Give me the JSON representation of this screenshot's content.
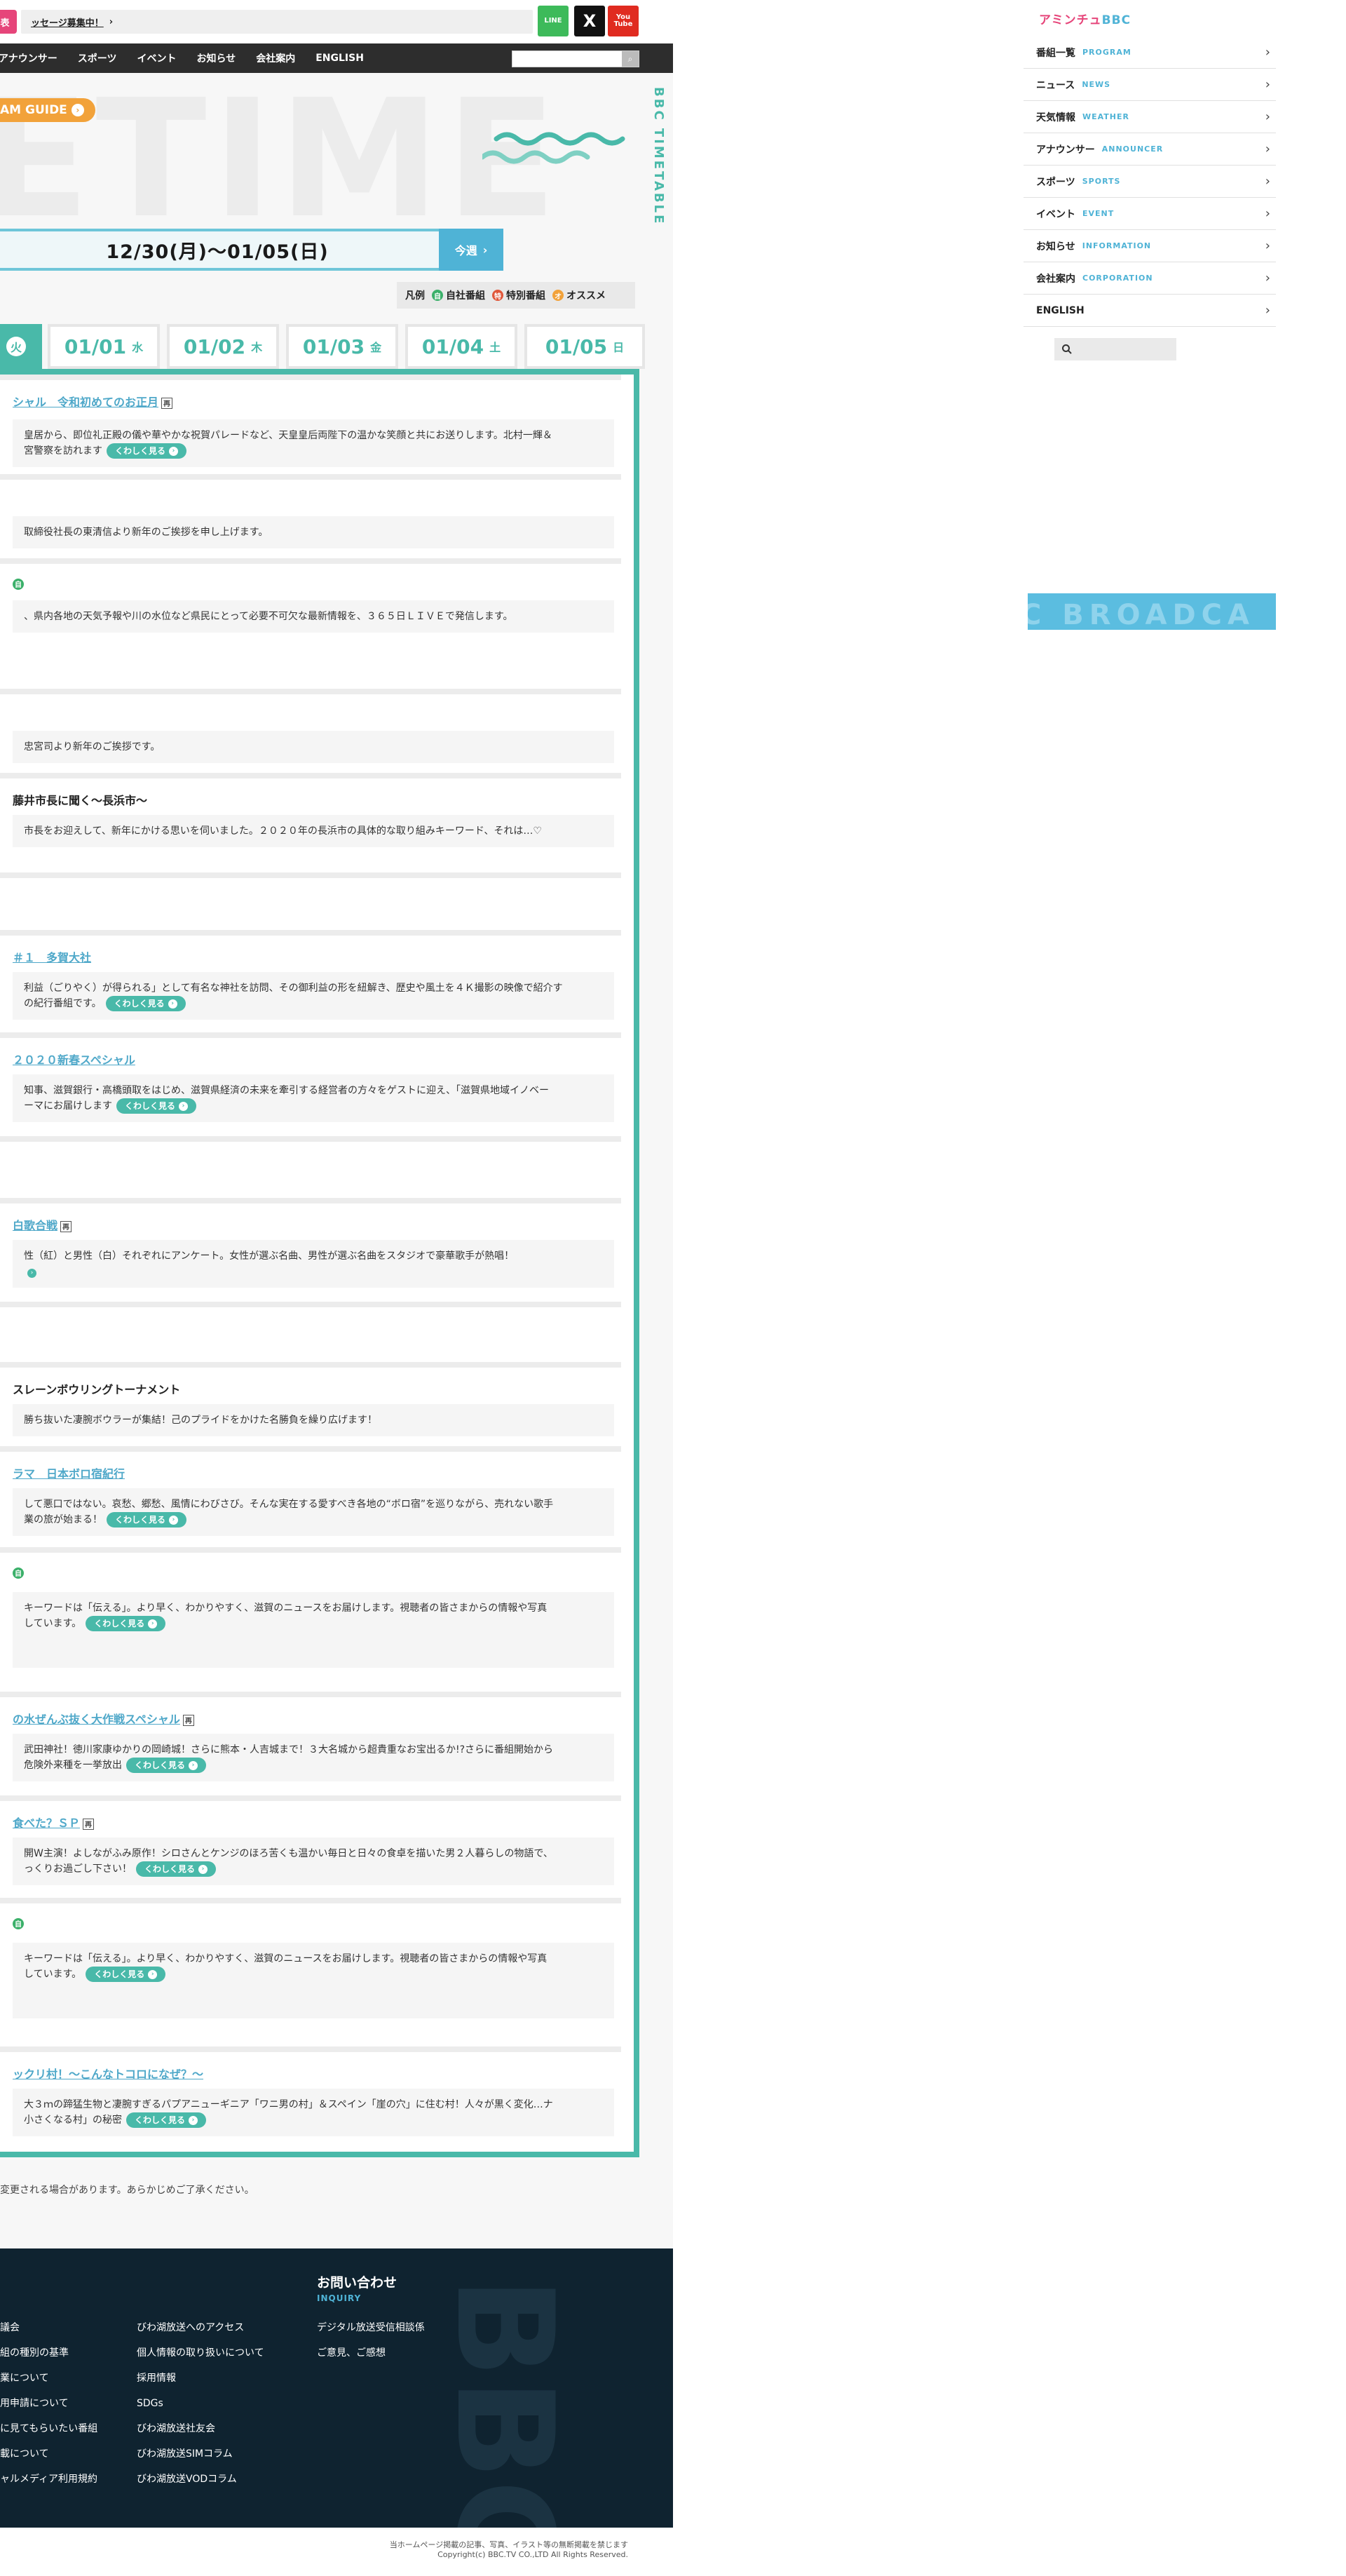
{
  "header": {
    "notice_badge": "表",
    "notice_text": "ッセージ募集中！",
    "notice_chevron": "›",
    "sns": {
      "line": "LINE",
      "x": "X",
      "youtube": "You Tube"
    },
    "nav": [
      "アナウンサー",
      "スポーツ",
      "イベント",
      "お知らせ",
      "会社案内",
      "ENGLISH"
    ],
    "search_icon": "search-icon"
  },
  "hero": {
    "bg_text": "ETIME",
    "vertical_title": "BBC TIMETABLE",
    "guide_label": "AM GUIDE",
    "guide_arrow": "›"
  },
  "week": {
    "range": "12/30(月)〜01/05(日)",
    "next_label": "今週",
    "next_arrow": "›"
  },
  "legend": {
    "label": "凡例",
    "items": [
      {
        "mark": "自",
        "text": "自社番組",
        "color": "#3bb06a"
      },
      {
        "mark": "特",
        "text": "特別番組",
        "color": "#e0573a"
      },
      {
        "mark": "オ",
        "text": "オススメ",
        "color": "#f2a23a"
      }
    ]
  },
  "days": [
    {
      "date": "",
      "dow": "火",
      "active": true
    },
    {
      "date": "01/01",
      "dow": "水",
      "active": false
    },
    {
      "date": "01/02",
      "dow": "木",
      "active": false
    },
    {
      "date": "01/03",
      "dow": "金",
      "active": false
    },
    {
      "date": "01/04",
      "dow": "土",
      "active": false
    },
    {
      "date": "01/05",
      "dow": "日",
      "active": false
    }
  ],
  "more_label": "くわしく見る",
  "programs": [
    {
      "title": "シャル　令和初めてのお正月",
      "tag": "再",
      "desc1": "皇居から、即位礼正殿の儀や華やかな祝賀パレードなど、天皇皇后両陛下の温かな笑顔と共にお送りします。北村一輝＆",
      "desc2": "宮警察を訪れます"
    },
    {
      "title": "",
      "desc1": "取締役社長の東清信より新年のご挨拶を申し上げます。"
    },
    {
      "title": "",
      "desc1": "、県内各地の天気予報や川の水位など県民にとって必要不可欠な最新情報を、３６５日ＬＩＶＥで発信します。"
    },
    {
      "title": "",
      "desc1": "忠宮司より新年のご挨拶です。"
    },
    {
      "title": "藤井市長に聞く～長浜市～",
      "desc1": "市長をお迎えして、新年にかける思いを伺いました。２０２０年の長浜市の具体的な取り組みキーワード、それは…♡"
    },
    {
      "title": "＃１　多賀大社",
      "desc1": "利益（ごりやく）が得られる」として有名な神社を訪問、その御利益の形を紐解き、歴史や風土を４Ｋ撮影の映像で紹介す",
      "desc2": "の紀行番組です。"
    },
    {
      "title": "２０２０新春スペシャル",
      "desc1": "知事、滋賀銀行・高橋頭取をはじめ、滋賀県経済の未来を牽引する経営者の方々をゲストに迎え、「滋賀県地域イノベー",
      "desc2": "ーマにお届けします"
    },
    {
      "title": "白歌合戦",
      "tag": "再",
      "desc1": "性（紅）と男性（白）それぞれにアンケート。女性が選ぶ名曲、男性が選ぶ名曲をスタジオで豪華歌手が熱唱！"
    },
    {
      "title": "スレーンボウリングトーナメント",
      "desc1": "勝ち抜いた凄腕ボウラーが集結！己のプライドをかけた名勝負を繰り広げます！"
    },
    {
      "title": "ラマ　日本ボロ宿紀行",
      "desc1": "して悪口ではない。哀愁、郷愁、風情にわびさび。そんな実在する愛すべき各地の“ボロ宿”を巡りながら、売れない歌手",
      "desc2": "業の旅が始まる！"
    },
    {
      "title": "",
      "desc1": "キーワードは「伝える」。より早く、わかりやすく、滋賀のニュースをお届けします。視聴者の皆さまからの情報や写真",
      "desc2": "しています。"
    },
    {
      "title": "の水ぜんぶ抜く大作戦スペシャル",
      "tag": "再",
      "desc1": "武田神社！徳川家康ゆかりの岡崎城！さらに熊本・人吉城まで！３大名城から超貴重なお宝出るか!?さらに番組開始から",
      "desc2": "危険外来種を一挙放出"
    },
    {
      "title": "食べた？ＳＰ",
      "tag": "再",
      "desc1": "開W主演！よしながふみ原作！シロさんとケンジのほろ苦くも温かい毎日と日々の食卓を描いた男２人暮らしの物語で、",
      "desc2": "っくりお過ごし下さい！"
    },
    {
      "title": "",
      "desc1": "キーワードは「伝える」。より早く、わかりやすく、滋賀のニュースをお届けします。視聴者の皆さまからの情報や写真",
      "desc2": "しています。"
    },
    {
      "title": "ックリ村！～こんなトコロになぜ？～",
      "desc1": "大３ｍの蹄猛生物と凄腕すぎるパプアニューギニア「ワニ男の村」＆スペイン「崖の穴」に住む村！人々が黒く変化…ナ",
      "desc2": "小さくなる村」の秘密"
    }
  ],
  "footnote": "変更される場合があります。あらかじめご了承ください。",
  "footer": {
    "inquiry_title": "お問い合わせ",
    "inquiry_sub": "INQUIRY",
    "col1": [
      "議会",
      "組の種別の基準",
      "業について",
      "用申請について",
      "に見てもらいたい番組",
      "載について",
      "ャルメディア利用規約"
    ],
    "col2": [
      "びわ湖放送へのアクセス",
      "個人情報の取り扱いについて",
      "採用情報",
      "SDGs",
      "びわ湖放送社友会",
      "びわ湖放送SIMコラム",
      "びわ湖放送VODコラム"
    ],
    "col3": [
      "デジタル放送受信相談係",
      "ご意見、ご感想"
    ],
    "big_text": "BBC",
    "copy1": "当ホームページ掲載の記事、写真、イラスト等の無断掲載を禁じます",
    "copy2": "Copyright(c) BBC.TV CO.,LTD All Rights Reserved."
  },
  "side": {
    "logo_main": "アミンチュ",
    "logo_sub": "BBC",
    "menu": [
      {
        "ja": "番組一覧",
        "en": "PROGRAM"
      },
      {
        "ja": "ニュース",
        "en": "NEWS"
      },
      {
        "ja": "天気情報",
        "en": "WEATHER"
      },
      {
        "ja": "アナウンサー",
        "en": "ANNOUNCER"
      },
      {
        "ja": "スポーツ",
        "en": "SPORTS"
      },
      {
        "ja": "イベント",
        "en": "EVENT"
      },
      {
        "ja": "お知らせ",
        "en": "INFORMATION"
      },
      {
        "ja": "会社案内",
        "en": "CORPORATION"
      },
      {
        "ja": "ENGLISH",
        "en": ""
      }
    ],
    "menu_chevron": "›",
    "banner_text": "C BROADCA"
  },
  "colors": {
    "accent": "#49b9a9",
    "link": "#4fa8c9",
    "guide": "#f2a23a",
    "footer": "#0f2330"
  }
}
